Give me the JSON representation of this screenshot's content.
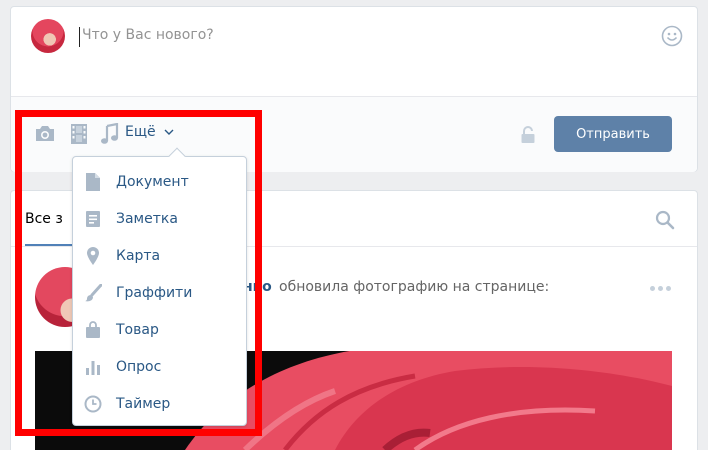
{
  "composer": {
    "placeholder": "Что у Вас нового?",
    "more_label": "Ещё",
    "send_label": "Отправить",
    "icons": [
      "photo-icon",
      "video-icon",
      "music-icon",
      "smile-icon",
      "lock-icon"
    ]
  },
  "dropdown": {
    "items": [
      {
        "label": "Документ",
        "icon": "document-icon"
      },
      {
        "label": "Заметка",
        "icon": "note-icon"
      },
      {
        "label": "Карта",
        "icon": "map-pin-icon"
      },
      {
        "label": "Граффити",
        "icon": "brush-icon"
      },
      {
        "label": "Товар",
        "icon": "bag-icon"
      },
      {
        "label": "Опрос",
        "icon": "poll-icon"
      },
      {
        "label": "Таймер",
        "icon": "clock-icon"
      }
    ]
  },
  "feed": {
    "tab_all": "Все з",
    "post": {
      "author_fragment": "нко",
      "action": "обновила фотографию на странице:"
    }
  },
  "colors": {
    "accent": "#2a5885",
    "button": "#5e81a8",
    "highlight": "#ff0000",
    "icon": "#aab8c7"
  }
}
